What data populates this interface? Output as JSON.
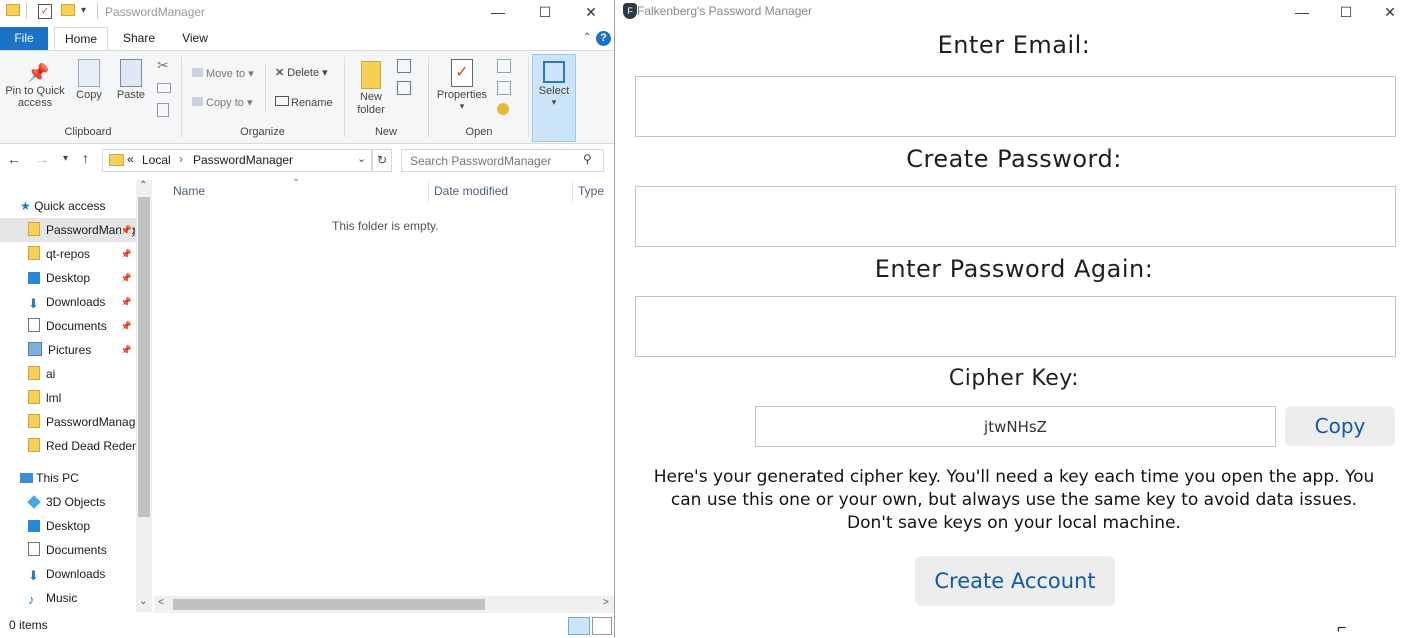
{
  "explorer": {
    "title": "PasswordManager",
    "tabs": [
      "File",
      "Home",
      "Share",
      "View"
    ],
    "ribbon": {
      "clipboard": {
        "pin": "Pin to Quick access",
        "copy": "Copy",
        "paste": "Paste",
        "label": "Clipboard"
      },
      "organize": {
        "move_to": "Move to",
        "copy_to": "Copy to",
        "delete": "Delete",
        "rename": "Rename",
        "label": "Organize"
      },
      "new": {
        "new_folder": "New folder",
        "label": "New"
      },
      "open": {
        "properties": "Properties",
        "label": "Open"
      },
      "select": {
        "select": "Select"
      }
    },
    "address": {
      "prefix": "«",
      "crumbs": [
        "Local",
        "PasswordManager"
      ]
    },
    "search_placeholder": "Search PasswordManager",
    "columns": [
      "Name",
      "Date modified",
      "Type"
    ],
    "empty_text": "This folder is empty.",
    "nav": {
      "quick_access": "Quick access",
      "quick_items": [
        "PasswordManager",
        "qt-repos",
        "Desktop",
        "Downloads",
        "Documents",
        "Pictures",
        "ai",
        "lml",
        "PasswordManager",
        "Red Dead Redemption"
      ],
      "this_pc": "This PC",
      "pc_items": [
        "3D Objects",
        "Desktop",
        "Documents",
        "Downloads",
        "Music"
      ]
    },
    "status": "0 items"
  },
  "pm": {
    "title": "Falkenberg's Password Manager",
    "email_label": "Enter Email:",
    "password_label": "Create Password:",
    "password_again_label": "Enter Password Again:",
    "cipher_label": "Cipher Key:",
    "cipher_value": "jtwNHsZ",
    "copy_button": "Copy",
    "info_line1": "Here's your generated cipher key. You'll need a key each time you open the app. You",
    "info_line2": "can use this one or your own, but always use the same key to avoid data issues.",
    "info_line3": "Don't save keys on your local machine.",
    "create_button": "Create Account"
  },
  "colors": {
    "accent": "#1a73c7",
    "button_text": "#0f5aa6",
    "button_bg": "#ededed"
  }
}
